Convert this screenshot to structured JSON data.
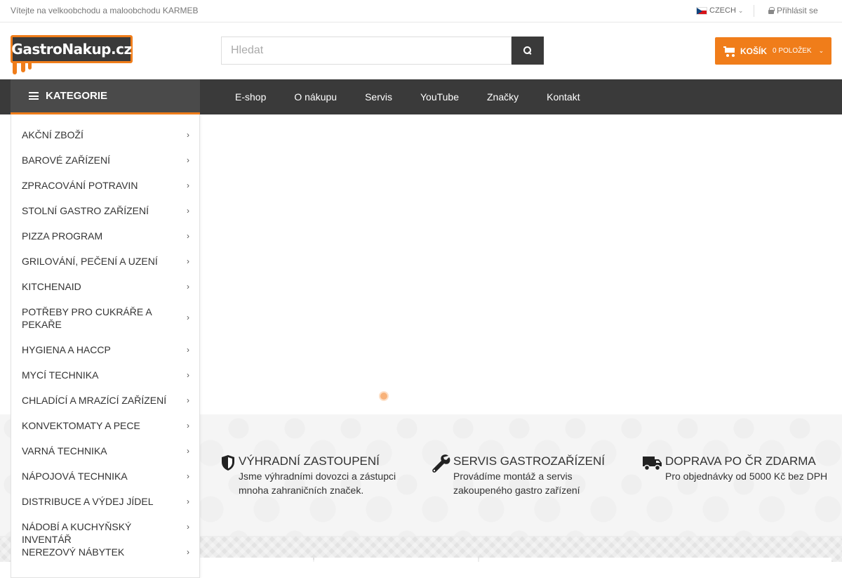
{
  "topbar": {
    "welcome": "Vítejte na velkoobchodu a maloobchodu KARMEB",
    "language": "CZECH",
    "login": "Přihlásit se"
  },
  "header": {
    "logo_text": "GastroNakup.cz",
    "search_placeholder": "Hledat",
    "cart_label": "KOŠÍK",
    "cart_count": "0 POLOŽEK"
  },
  "nav": {
    "categories_label": "KATEGORIE",
    "links": [
      "E-shop",
      "O nákupu",
      "Servis",
      "YouTube",
      "Značky",
      "Kontakt"
    ]
  },
  "categories": [
    "AKČNÍ ZBOŽÍ",
    "BAROVÉ ZAŘÍZENÍ",
    "ZPRACOVÁNÍ POTRAVIN",
    "STOLNÍ GASTRO ZAŘÍZENÍ",
    "PIZZA PROGRAM",
    "GRILOVÁNÍ, PEČENÍ A UZENÍ",
    "KITCHENAID",
    "POTŘEBY PRO CUKRÁŘE A PEKAŘE",
    "HYGIENA A HACCP",
    "MYCÍ TECHNIKA",
    "CHLADÍCÍ A MRAZÍCÍ ZAŘÍZENÍ",
    "KONVEKTOMATY A PECE",
    "VARNÁ TECHNIKA",
    "NÁPOJOVÁ TECHNIKA",
    "DISTRIBUCE A VÝDEJ JÍDEL",
    "NÁDOBÍ A KUCHYŇSKÝ INVENTÁŘ",
    "NEREZOVÝ NÁBYTEK"
  ],
  "features": [
    {
      "icon": "shield-icon",
      "title": "VÝHRADNÍ ZASTOUPENÍ",
      "text": "Jsme výhradními dovozci a zástupci mnoha zahraničních značek."
    },
    {
      "icon": "wrench-icon",
      "title": "SERVIS GASTROZAŘÍZENÍ",
      "text": "Provádíme montáž a servis zakoupeného gastro zařízení"
    },
    {
      "icon": "truck-icon",
      "title": "DOPRAVA PO ČR ZDARMA",
      "text": "Pro objednávky od 5000 Kč bez DPH"
    }
  ],
  "colors": {
    "accent": "#f07d1a",
    "dark": "#3a3a3a"
  }
}
